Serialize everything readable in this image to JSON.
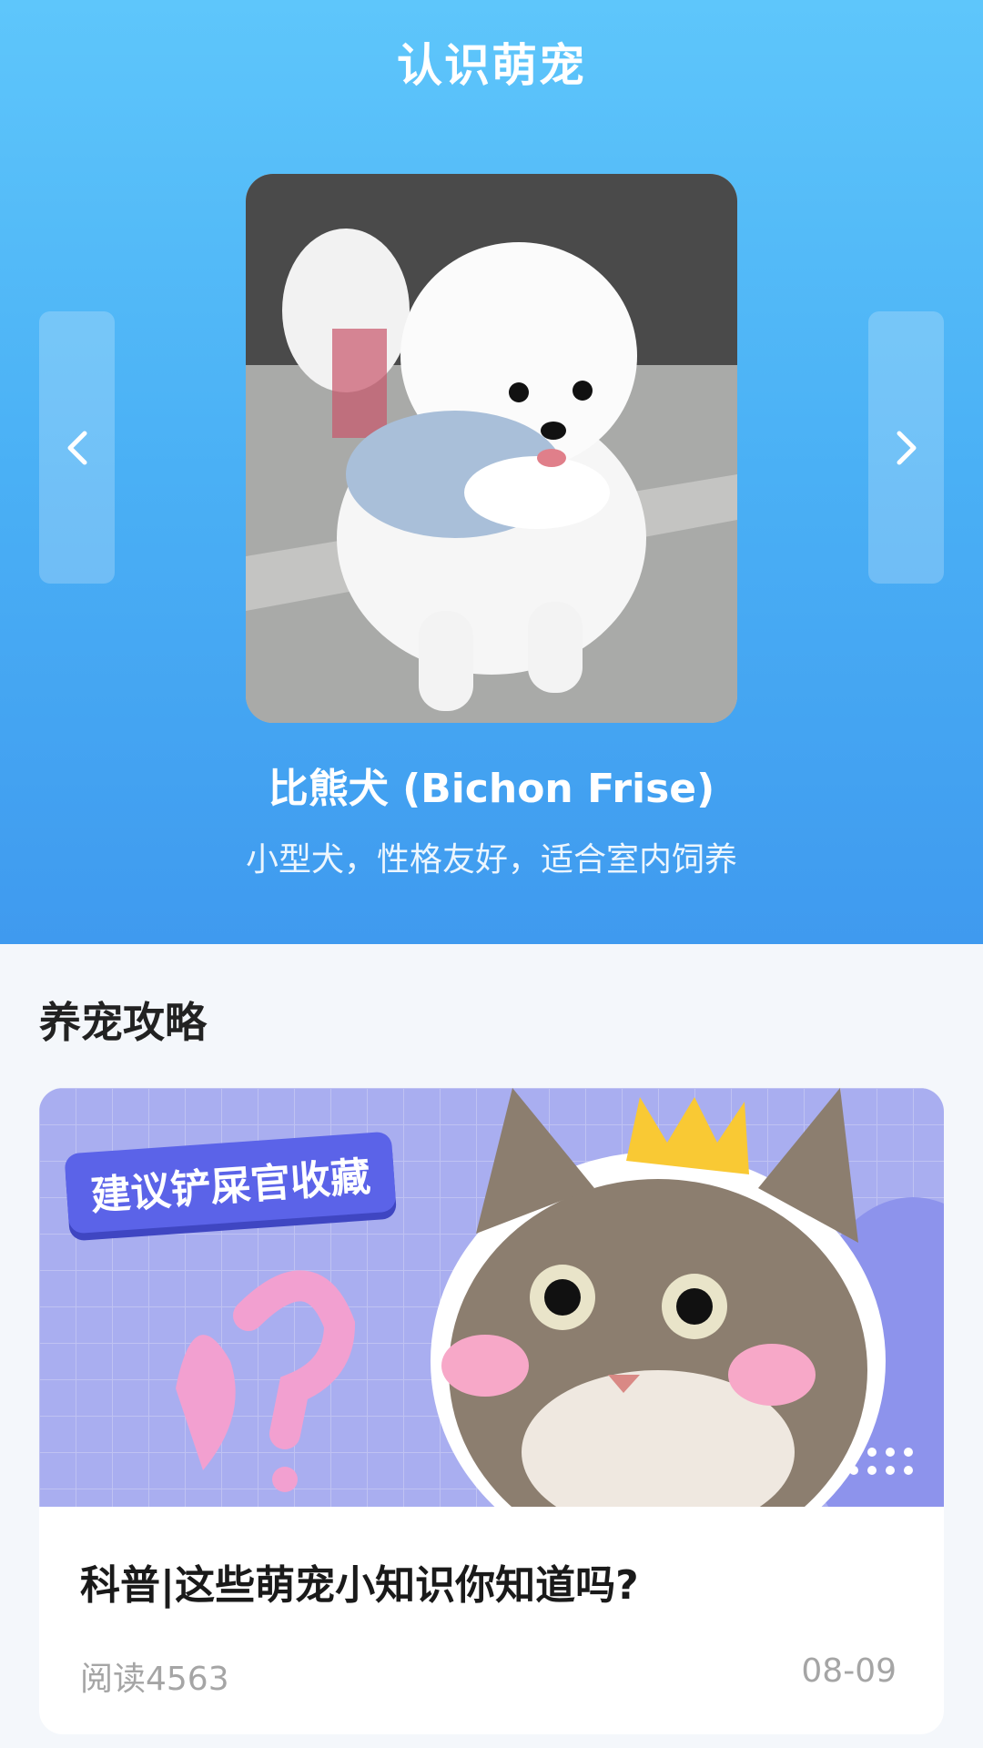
{
  "header": {
    "title": "认识萌宠"
  },
  "carousel": {
    "prev_icon": "chevron-left-icon",
    "next_icon": "chevron-right-icon",
    "pet_name": "比熊犬 (Bichon Frise)",
    "pet_description": "小型犬，性格友好，适合室内饲养"
  },
  "guides": {
    "title": "养宠攻略",
    "articles": [
      {
        "cover_badge": "建议铲屎官收藏",
        "title": "科普|这些萌宠小知识你知道吗?",
        "reads": "阅读4563",
        "date": "08-09"
      }
    ]
  },
  "colors": {
    "hero_top": "#5ec6fb",
    "hero_bottom": "#3f9aef",
    "page_background": "#f4f7fb",
    "badge": "#5b63e8"
  }
}
